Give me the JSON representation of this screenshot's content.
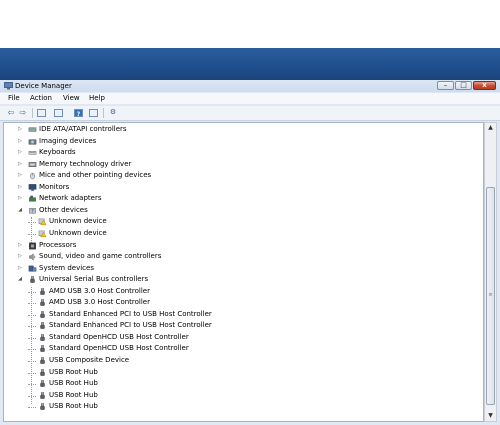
{
  "window": {
    "title": "Device Manager",
    "icon": "computer-icon",
    "controls": {
      "minimize": "–",
      "maximize": "□",
      "close": "x"
    }
  },
  "menu": [
    "File",
    "Action",
    "View",
    "Help"
  ],
  "toolbar": [
    "back-arrow-icon",
    "forward-arrow-icon",
    "properties-icon",
    "console-tree-icon",
    "help-icon",
    "device-list-icon",
    "scan-hardware-icon"
  ],
  "tree": [
    {
      "label": "IDE ATA/ATAPI controllers",
      "icon": "ide-controller-icon",
      "level": 1,
      "state": "collapsed"
    },
    {
      "label": "Imaging devices",
      "icon": "camera-icon",
      "level": 1,
      "state": "collapsed"
    },
    {
      "label": "Keyboards",
      "icon": "keyboard-icon",
      "level": 1,
      "state": "collapsed"
    },
    {
      "label": "Memory technology driver",
      "icon": "memory-icon",
      "level": 1,
      "state": "collapsed"
    },
    {
      "label": "Mice and other pointing devices",
      "icon": "mouse-icon",
      "level": 1,
      "state": "collapsed"
    },
    {
      "label": "Monitors",
      "icon": "monitor-icon",
      "level": 1,
      "state": "collapsed"
    },
    {
      "label": "Network adapters",
      "icon": "network-adapter-icon",
      "level": 1,
      "state": "collapsed"
    },
    {
      "label": "Other devices",
      "icon": "other-devices-icon",
      "level": 1,
      "state": "expanded"
    },
    {
      "label": "Unknown device",
      "icon": "unknown-device-warning-icon",
      "level": 2
    },
    {
      "label": "Unknown device",
      "icon": "unknown-device-warning-icon",
      "level": 2
    },
    {
      "label": "Processors",
      "icon": "processor-icon",
      "level": 1,
      "state": "collapsed"
    },
    {
      "label": "Sound, video and game controllers",
      "icon": "speaker-icon",
      "level": 1,
      "state": "collapsed"
    },
    {
      "label": "System devices",
      "icon": "system-devices-icon",
      "level": 1,
      "state": "collapsed"
    },
    {
      "label": "Universal Serial Bus controllers",
      "icon": "usb-plug-icon",
      "level": 1,
      "state": "expanded"
    },
    {
      "label": "AMD USB 3.0 Host Controller",
      "icon": "usb-plug-icon",
      "level": 2
    },
    {
      "label": "AMD USB 3.0 Host Controller",
      "icon": "usb-plug-icon",
      "level": 2
    },
    {
      "label": "Standard Enhanced PCI to USB Host Controller",
      "icon": "usb-plug-icon",
      "level": 2
    },
    {
      "label": "Standard Enhanced PCI to USB Host Controller",
      "icon": "usb-plug-icon",
      "level": 2
    },
    {
      "label": "Standard OpenHCD USB Host Controller",
      "icon": "usb-plug-icon",
      "level": 2
    },
    {
      "label": "Standard OpenHCD USB Host Controller",
      "icon": "usb-plug-icon",
      "level": 2
    },
    {
      "label": "USB Composite Device",
      "icon": "usb-plug-icon",
      "level": 2
    },
    {
      "label": "USB Root Hub",
      "icon": "usb-plug-icon",
      "level": 2
    },
    {
      "label": "USB Root Hub",
      "icon": "usb-plug-icon",
      "level": 2
    },
    {
      "label": "USB Root Hub",
      "icon": "usb-plug-icon",
      "level": 2
    },
    {
      "label": "USB Root Hub",
      "icon": "usb-plug-icon",
      "level": 2
    }
  ],
  "colors": {
    "desktop_bar": "#1f4e8b",
    "close_button": "#c8482f",
    "window_frame": "#dfe8f3"
  }
}
